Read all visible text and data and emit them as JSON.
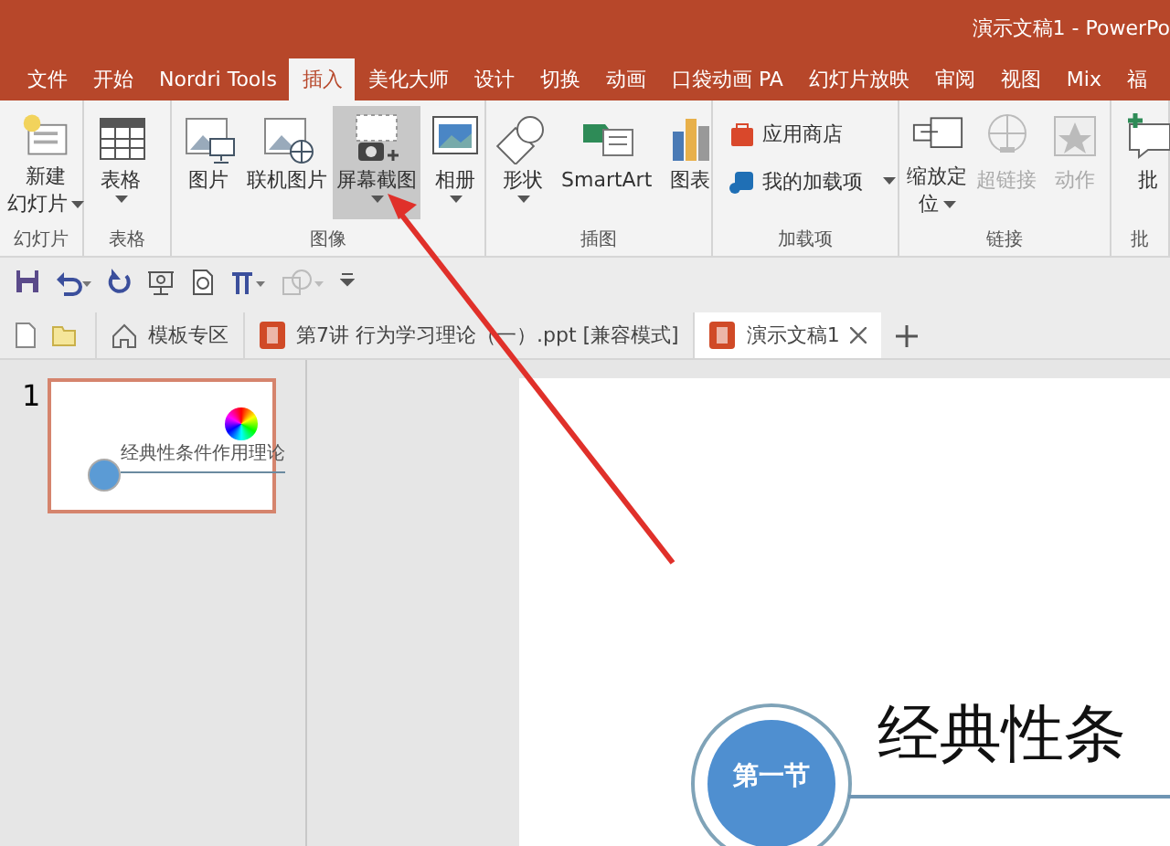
{
  "window": {
    "title": "演示文稿1 - PowerPo"
  },
  "ribbon_tabs": [
    {
      "label": "文件",
      "selected": false
    },
    {
      "label": "开始",
      "selected": false
    },
    {
      "label": "Nordri Tools",
      "selected": false
    },
    {
      "label": "插入",
      "selected": true
    },
    {
      "label": "美化大师",
      "selected": false
    },
    {
      "label": "设计",
      "selected": false
    },
    {
      "label": "切换",
      "selected": false
    },
    {
      "label": "动画",
      "selected": false
    },
    {
      "label": "口袋动画 PA",
      "selected": false
    },
    {
      "label": "幻灯片放映",
      "selected": false
    },
    {
      "label": "审阅",
      "selected": false
    },
    {
      "label": "视图",
      "selected": false
    },
    {
      "label": "Mix",
      "selected": false
    },
    {
      "label": "福",
      "selected": false
    }
  ],
  "ribbon_groups": [
    {
      "label": "幻灯片",
      "items": [
        {
          "kind": "large",
          "label": [
            "新建",
            "幻灯片"
          ],
          "has_menu": true,
          "selected": false,
          "disabled": false
        }
      ]
    },
    {
      "label": "表格",
      "items": [
        {
          "kind": "large",
          "label": "表格",
          "has_menu": true,
          "selected": false,
          "disabled": false
        }
      ]
    },
    {
      "label": "图像",
      "items": [
        {
          "kind": "large",
          "label": "图片",
          "has_menu": false,
          "selected": false,
          "disabled": false
        },
        {
          "kind": "large",
          "label": "联机图片",
          "has_menu": false,
          "selected": false,
          "disabled": false
        },
        {
          "kind": "large",
          "label": "屏幕截图",
          "has_menu": true,
          "selected": true,
          "disabled": false
        },
        {
          "kind": "large",
          "label": "相册",
          "has_menu": true,
          "selected": false,
          "disabled": false
        }
      ]
    },
    {
      "label": "插图",
      "items": [
        {
          "kind": "large",
          "label": "形状",
          "has_menu": true,
          "selected": false,
          "disabled": false
        },
        {
          "kind": "large",
          "label": "SmartArt",
          "has_menu": false,
          "selected": false,
          "disabled": false
        },
        {
          "kind": "large",
          "label": "图表",
          "has_menu": false,
          "selected": false,
          "disabled": false
        }
      ]
    },
    {
      "label": "加载项",
      "items": [
        {
          "kind": "small",
          "label": "应用商店",
          "has_menu": false,
          "selected": false,
          "disabled": false
        },
        {
          "kind": "small",
          "label": "我的加载项",
          "has_menu": true,
          "selected": false,
          "disabled": false
        }
      ]
    },
    {
      "label": "链接",
      "items": [
        {
          "kind": "large",
          "label": [
            "缩放定",
            "位"
          ],
          "has_menu": true,
          "selected": false,
          "disabled": false
        },
        {
          "kind": "large",
          "label": "超链接",
          "has_menu": false,
          "selected": false,
          "disabled": true
        },
        {
          "kind": "large",
          "label": "动作",
          "has_menu": false,
          "selected": false,
          "disabled": true
        }
      ]
    },
    {
      "label": "批",
      "items": [
        {
          "kind": "large",
          "label": "批",
          "has_menu": false,
          "selected": false,
          "disabled": false
        }
      ]
    }
  ],
  "doc_tabs": [
    {
      "label": "模板专区",
      "selected": false,
      "closable": false
    },
    {
      "label": "第7讲 行为学习理论（一）.ppt [兼容模式]",
      "selected": false,
      "closable": false
    },
    {
      "label": "演示文稿1",
      "selected": true,
      "closable": true
    }
  ],
  "slides_pane": {
    "slides": [
      {
        "number": "1",
        "selected": true,
        "title": "经典性条件作用理论"
      }
    ]
  },
  "slide": {
    "badge": "第一节",
    "title": "经典性条"
  }
}
